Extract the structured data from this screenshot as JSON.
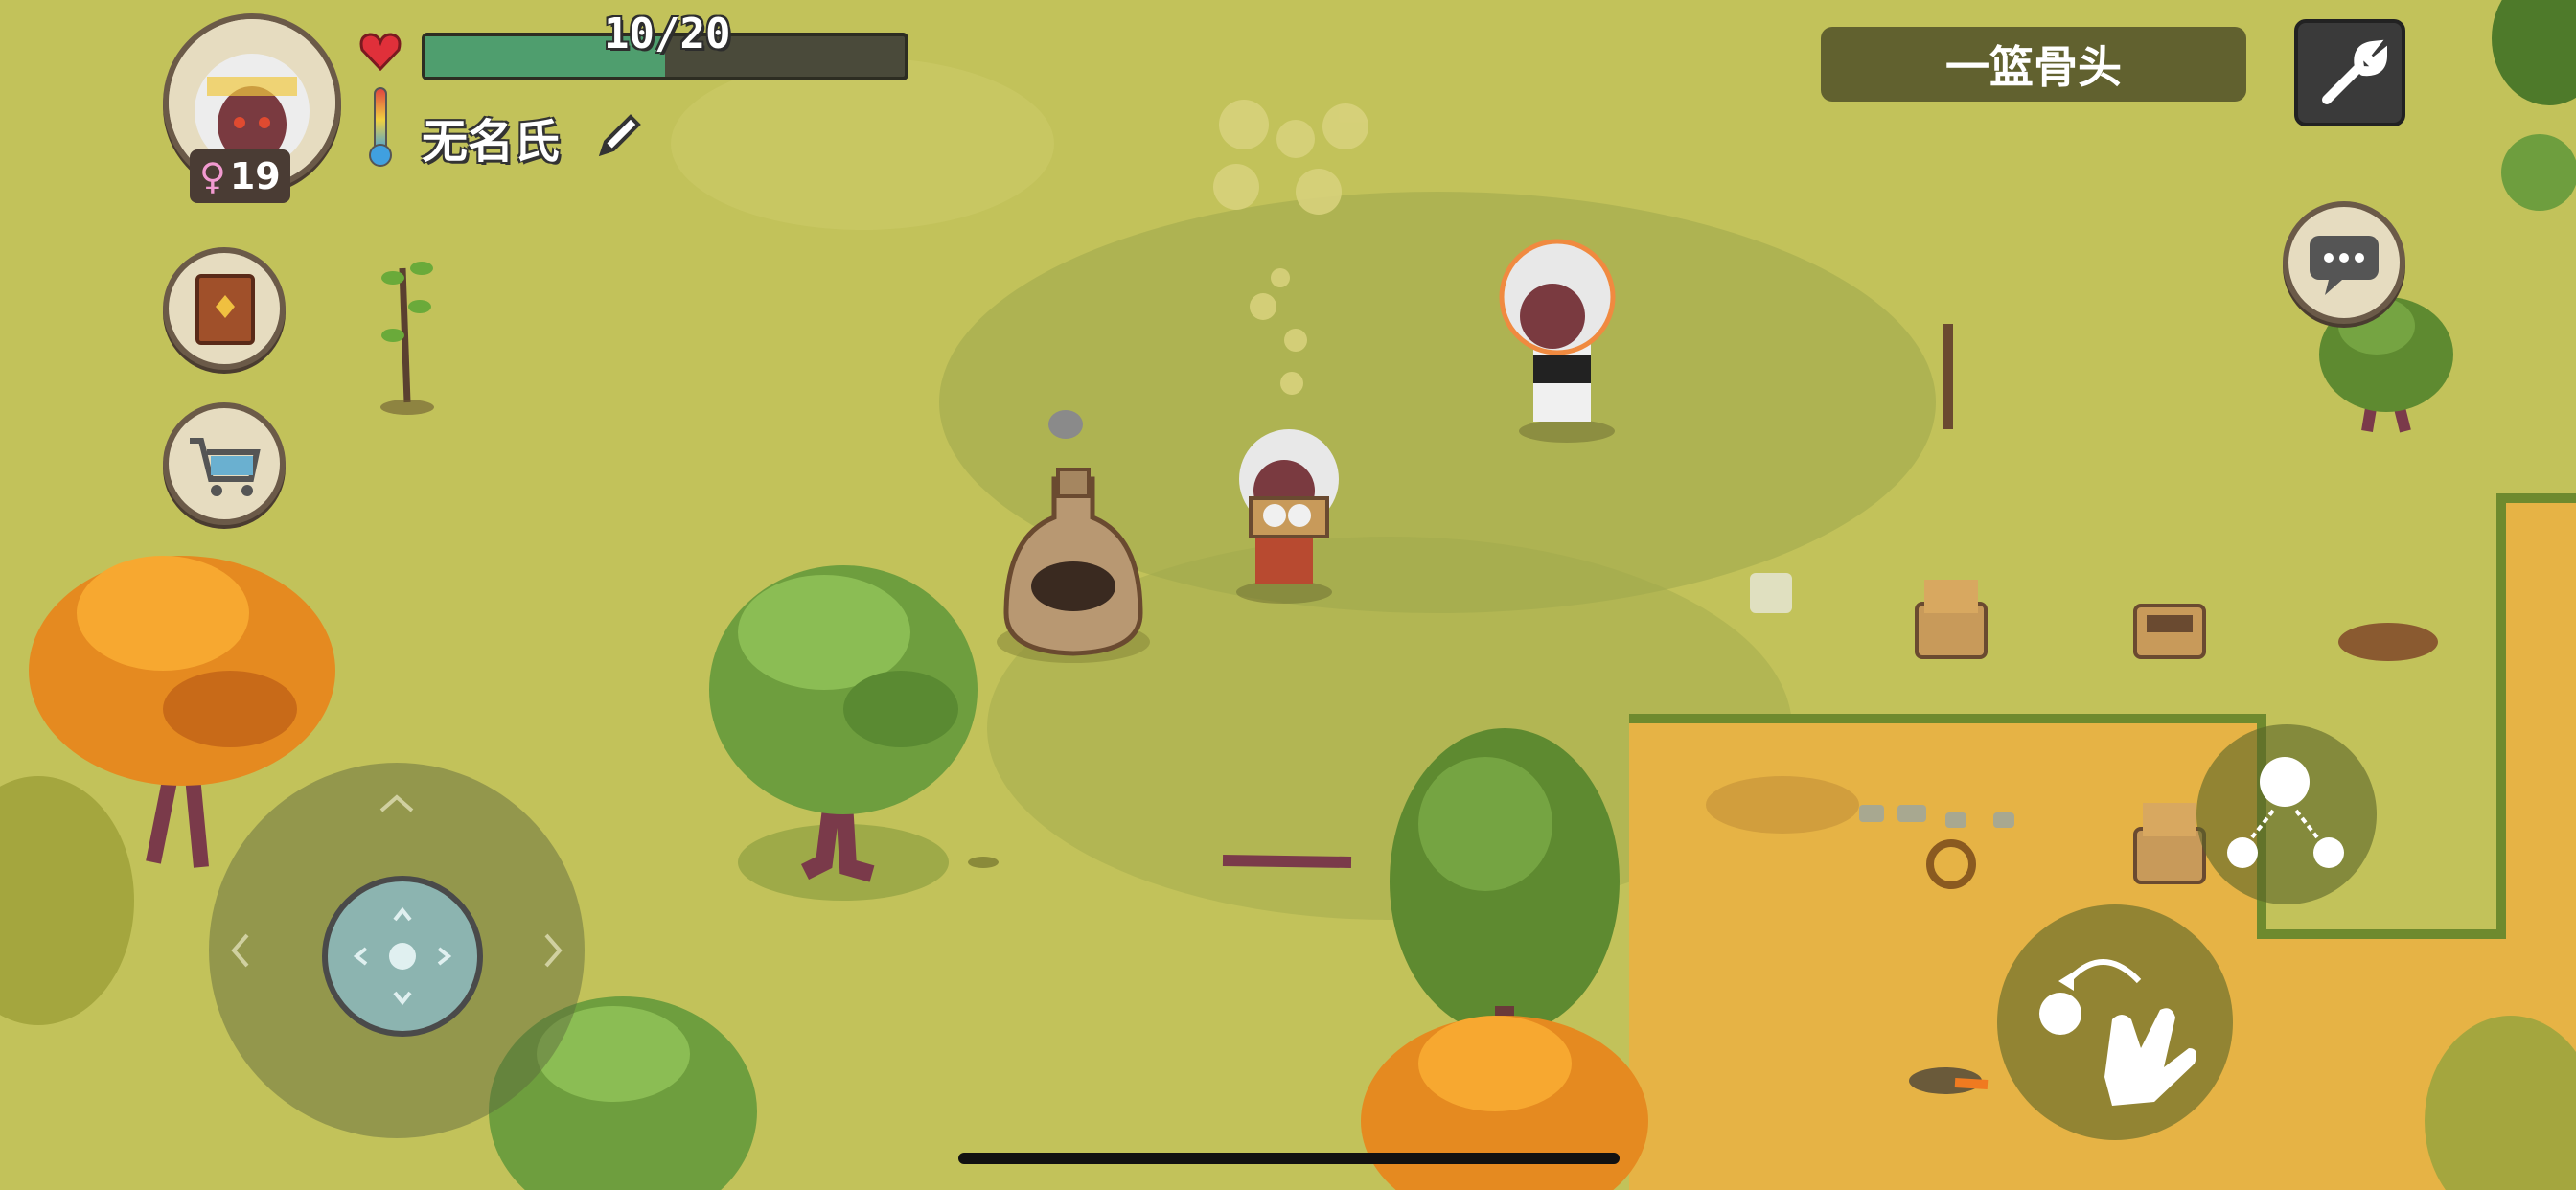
{
  "hud": {
    "health": {
      "current": 10,
      "max": 20,
      "text": "10/20",
      "fill_fraction": 0.5
    },
    "player_name": "无名氏",
    "age": "19",
    "gender_symbol": "♀",
    "held_item_label": "一篮骨头"
  },
  "icons": {
    "heart": "heart-icon",
    "thermometer": "thermometer-icon",
    "edit": "pencil-icon",
    "settings": "wrench-icon",
    "chat": "speech-bubble-icon",
    "recipe_book": "book-icon",
    "shop": "shopping-cart-icon",
    "joystick": "dpad-icon",
    "action": "grab-hand-icon",
    "group": "people-network-icon"
  },
  "colors": {
    "grass": "#c2c25a",
    "sand": "#e8b44a",
    "health_fill": "#4f9e6e",
    "health_bg": "#4a4a3a",
    "hud_panel": "#e6dcc0"
  }
}
